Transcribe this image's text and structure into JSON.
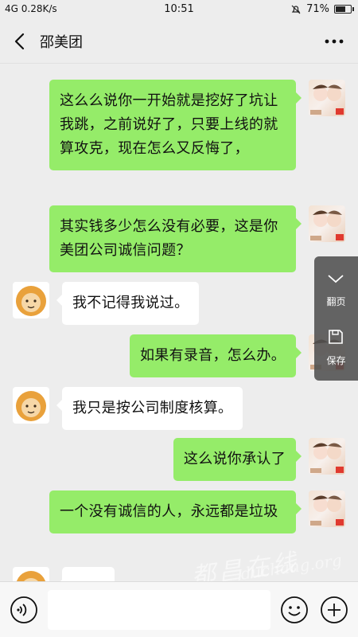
{
  "status_bar": {
    "network": "4G 0.28K/s",
    "time": "10:51",
    "battery": "71%",
    "battery_level": 0.71
  },
  "header": {
    "title": "邵美团"
  },
  "messages": [
    {
      "side": "sent",
      "text": "这么么说你一开始就是挖好了坑让我跳，之前说好了，只要上线的就算攻克，现在怎么又反悔了，"
    },
    {
      "side": "sent",
      "text": "其实钱多少怎么没有必要，这是你美团公司诚信问题？"
    },
    {
      "side": "recv",
      "text": "我不记得我说过。"
    },
    {
      "side": "sent",
      "text": "如果有录音，怎么办。"
    },
    {
      "side": "recv",
      "text": "我只是按公司制度核算。"
    },
    {
      "side": "sent",
      "text": "这么说你承认了"
    },
    {
      "side": "sent",
      "text": "一个没有诚信的人，永远都是垃圾"
    }
  ],
  "float_panel": {
    "page_turn": "翻页",
    "save": "保存"
  },
  "watermark": {
    "text": "都昌在线",
    "url": "duchang.org"
  },
  "colors": {
    "sent_bubble": "#95ec69",
    "recv_bubble": "#ffffff",
    "background": "#ededed"
  }
}
